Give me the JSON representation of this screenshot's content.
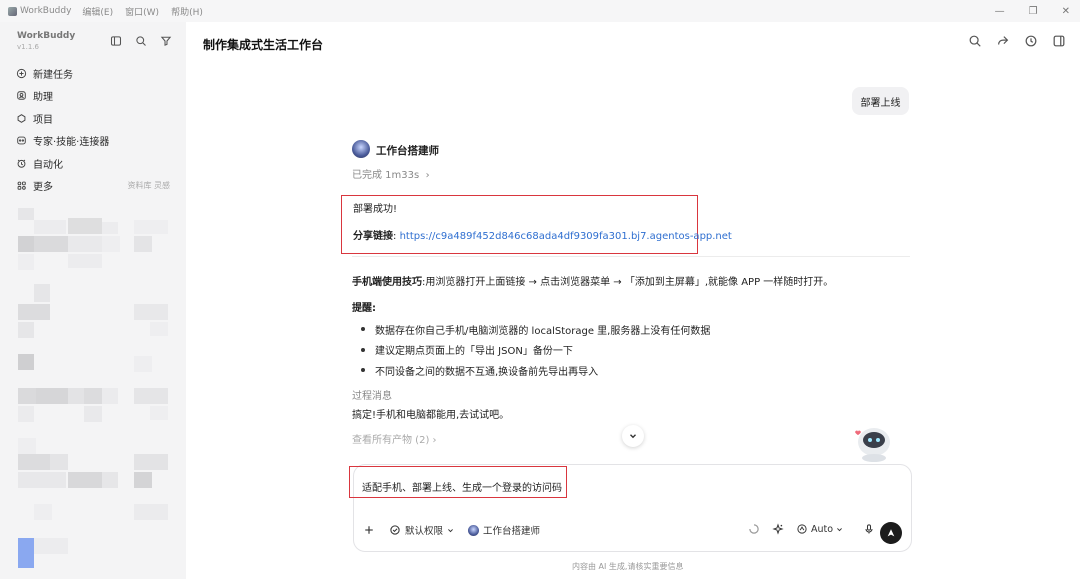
{
  "titlebar": {
    "app_name": "WorkBuddy",
    "menu": [
      "编辑(E)",
      "窗口(W)",
      "帮助(H)"
    ],
    "window_controls": [
      "minimize-icon",
      "restore-icon",
      "close-icon"
    ]
  },
  "sidebar": {
    "brand": "WorkBuddy",
    "version": "v1.1.6",
    "tools": [
      "sidebar-toggle-icon",
      "search-icon",
      "filter-icon"
    ],
    "items": [
      {
        "label": "新建任务",
        "icon": "plus-circle-icon"
      },
      {
        "label": "助理",
        "icon": "assistant-icon"
      },
      {
        "label": "项目",
        "icon": "project-icon"
      },
      {
        "label": "专家·技能·连接器",
        "icon": "expert-icon"
      },
      {
        "label": "自动化",
        "icon": "automation-icon"
      },
      {
        "label": "更多",
        "icon": "more-grid-icon",
        "extra": "资料库  灵感"
      }
    ]
  },
  "header": {
    "title": "制作集成式生活工作台",
    "icons": [
      "search-icon",
      "share-icon",
      "history-icon",
      "panel-icon"
    ]
  },
  "conversation": {
    "user_message": "部署上线",
    "agent_name": "工作台搭建师",
    "status": "已完成 1m33s",
    "deploy_success": "部署成功!",
    "share_label": "分享链接",
    "share_sep": ":",
    "share_url": "https://c9a489f452d846c68ada4df9309fa301.bj7.agentos-app.net",
    "tips_label": "手机端使用技巧",
    "tips_text": ":用浏览器打开上面链接 → 点击浏览器菜单 → 「添加到主屏幕」,就能像 APP 一样随时打开。",
    "remind_label": "提醒:",
    "reminders": [
      "数据存在你自己手机/电脑浏览器的 localStorage 里,服务器上没有任何数据",
      "建议定期点页面上的「导出 JSON」备份一下",
      "不同设备之间的数据不互通,换设备前先导出再导入"
    ],
    "process_label": "过程消息",
    "process_text": "搞定!手机和电脑都能用,去试试吧。",
    "artifacts_link": "查看所有产物 (2) ›"
  },
  "composer": {
    "input_value": "适配手机、部署上线、生成一个登录的访问码",
    "permission": "默认权限",
    "agent": "工作台搭建师",
    "model": "Auto"
  },
  "footer": "内容由 AI 生成,请核实重要信息",
  "colors": {
    "highlight_red": "#d9363e",
    "link_blue": "#2f6fd0",
    "sidebar_bg": "#f4f4f5"
  }
}
